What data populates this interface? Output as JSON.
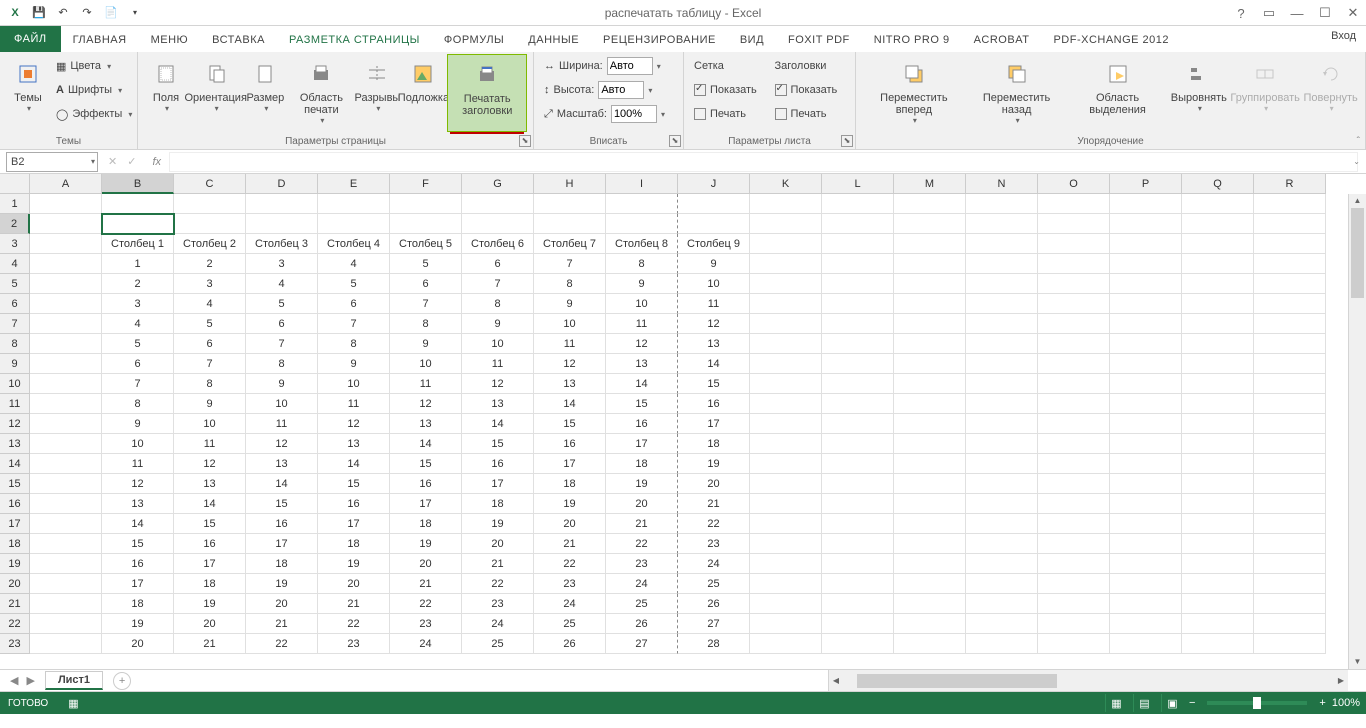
{
  "title": "распечатать таблицу - Excel",
  "qat": {
    "save": "💾",
    "undo": "↶",
    "redo": "↷",
    "new": "📄"
  },
  "tabs": [
    "ФАЙЛ",
    "ГЛАВНАЯ",
    "Меню",
    "ВСТАВКА",
    "РАЗМЕТКА СТРАНИЦЫ",
    "ФОРМУЛЫ",
    "ДАННЫЕ",
    "РЕЦЕНЗИРОВАНИЕ",
    "ВИД",
    "Foxit PDF",
    "NITRO PRO 9",
    "ACROBAT",
    "PDF-XChange 2012"
  ],
  "active_tab_index": 4,
  "signin": "Вход",
  "ribbon": {
    "themes": {
      "label": "Темы",
      "btn": "Темы",
      "colors": "Цвета",
      "fonts": "Шрифты",
      "effects": "Эффекты"
    },
    "pagesetup": {
      "label": "Параметры страницы",
      "margins": "Поля",
      "orientation": "Ориентация",
      "size": "Размер",
      "printarea": "Область печати",
      "breaks": "Разрывы",
      "background": "Подложка",
      "printtitles": "Печатать заголовки"
    },
    "fit": {
      "label": "Вписать",
      "width_l": "Ширина:",
      "width_v": "Авто",
      "height_l": "Высота:",
      "height_v": "Авто",
      "scale_l": "Масштаб:",
      "scale_v": "100%"
    },
    "sheetopts": {
      "label": "Параметры листа",
      "grid": "Сетка",
      "head": "Заголовки",
      "show": "Показать",
      "print": "Печать"
    },
    "arrange": {
      "label": "Упорядочение",
      "forward": "Переместить вперед",
      "backward": "Переместить назад",
      "pane": "Область выделения",
      "align": "Выровнять",
      "group": "Группировать",
      "rotate": "Повернуть"
    }
  },
  "namebox": "B2",
  "columns": [
    "A",
    "B",
    "C",
    "D",
    "E",
    "F",
    "G",
    "H",
    "I",
    "J",
    "K",
    "L",
    "M",
    "N",
    "O",
    "P",
    "Q",
    "R"
  ],
  "sel_col_index": 1,
  "sel_row_index": 1,
  "headers": [
    "Столбец 1",
    "Столбец 2",
    "Столбец 3",
    "Столбец 4",
    "Столбец 5",
    "Столбец 6",
    "Столбец 7",
    "Столбец 8",
    "Столбец 9"
  ],
  "data_first_row": 4,
  "data_rows": 20,
  "row_count": 23,
  "sheet": {
    "name": "Лист1"
  },
  "status": {
    "ready": "ГОТОВО",
    "zoom": "100%"
  }
}
